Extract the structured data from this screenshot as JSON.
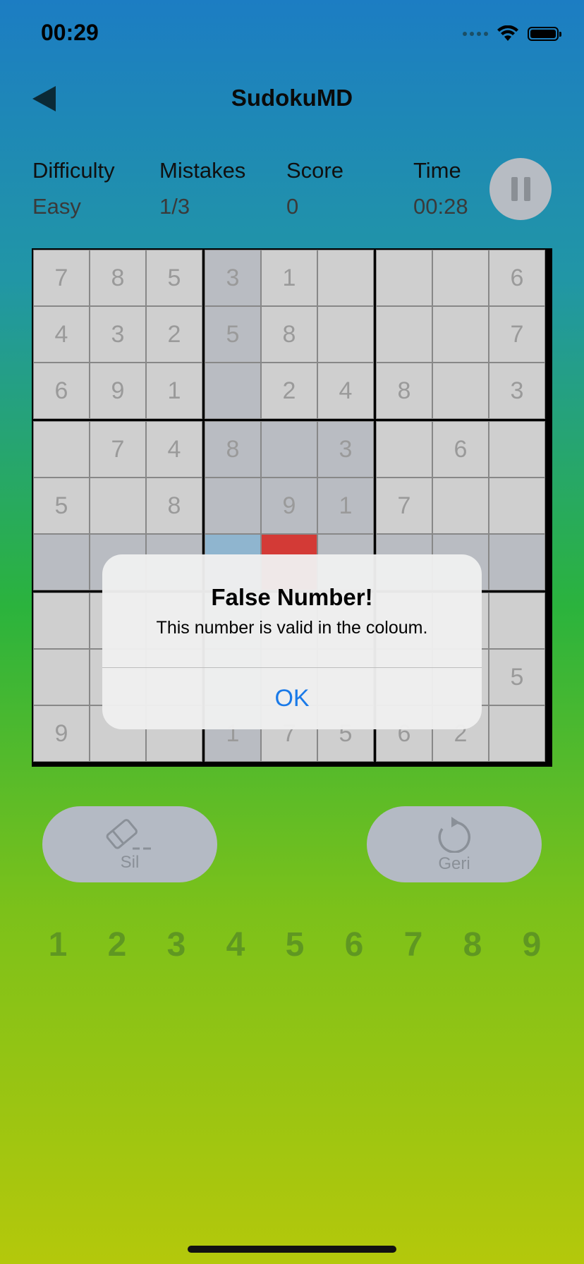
{
  "status_bar": {
    "time": "00:29"
  },
  "nav": {
    "title": "SudokuMD"
  },
  "stats": {
    "difficulty": {
      "label": "Difficulty",
      "value": "Easy"
    },
    "mistakes": {
      "label": "Mistakes",
      "value": "1/3"
    },
    "score": {
      "label": "Score",
      "value": "0"
    },
    "time": {
      "label": "Time",
      "value": "00:28"
    }
  },
  "board": {
    "rows": [
      [
        "7",
        "8",
        "5",
        "3",
        "1",
        "",
        "",
        "",
        "6"
      ],
      [
        "4",
        "3",
        "2",
        "5",
        "8",
        "",
        "",
        "",
        "7"
      ],
      [
        "6",
        "9",
        "1",
        "",
        "2",
        "4",
        "8",
        "",
        "3"
      ],
      [
        "",
        "7",
        "4",
        "8",
        "",
        "3",
        "",
        "6",
        ""
      ],
      [
        "5",
        "",
        "8",
        "",
        "9",
        "1",
        "7",
        "",
        ""
      ],
      [
        "",
        "",
        "",
        "",
        "",
        "",
        "",
        "",
        ""
      ],
      [
        "",
        "",
        "",
        "",
        "",
        "",
        "",
        "",
        ""
      ],
      [
        "",
        "",
        "",
        "",
        "",
        "",
        "",
        "",
        "5"
      ],
      [
        "9",
        "",
        "",
        "1",
        "7",
        "5",
        "6",
        "2",
        ""
      ]
    ],
    "highlighted": [
      [
        0,
        3
      ],
      [
        1,
        3
      ],
      [
        2,
        3
      ],
      [
        3,
        3
      ],
      [
        3,
        4
      ],
      [
        3,
        5
      ],
      [
        4,
        3
      ],
      [
        4,
        4
      ],
      [
        4,
        5
      ],
      [
        5,
        0
      ],
      [
        5,
        1
      ],
      [
        5,
        2
      ],
      [
        5,
        5
      ],
      [
        5,
        6
      ],
      [
        5,
        7
      ],
      [
        5,
        8
      ],
      [
        6,
        3
      ],
      [
        7,
        3
      ],
      [
        8,
        3
      ]
    ],
    "selected": [
      5,
      3
    ],
    "error": [
      5,
      4
    ],
    "colors": {
      "cell": "#cfcfcf",
      "highlight": "#b9bcc2",
      "selected": "#8fb5cf",
      "error": "#d33a36"
    }
  },
  "alert": {
    "title": "False Number!",
    "message": "This number is valid in the coloum.",
    "ok_label": "OK",
    "ok_color": "#1a7ae8"
  },
  "tools": {
    "erase": {
      "label": "Sil",
      "icon": "eraser-icon"
    },
    "undo": {
      "label": "Geri",
      "icon": "undo-icon"
    }
  },
  "numpad": [
    "1",
    "2",
    "3",
    "4",
    "5",
    "6",
    "7",
    "8",
    "9"
  ]
}
